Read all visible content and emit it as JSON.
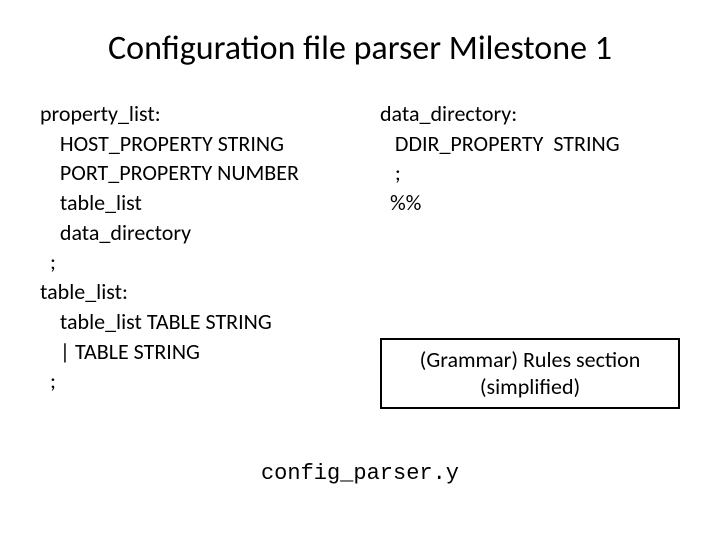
{
  "title": "Configuration file parser Milestone 1",
  "left_grammar": "property_list:\n    HOST_PROPERTY STRING\n    PORT_PROPERTY NUMBER\n    table_list\n    data_directory\n  ;\ntable_list:\n    table_list TABLE STRING\n    | TABLE STRING\n  ;",
  "right_grammar": "data_directory:\n   DDIR_PROPERTY  STRING\n   ;\n  %%",
  "caption_line1": "(Grammar) Rules section",
  "caption_line2": "(simplified)",
  "filename": "config_parser.y"
}
